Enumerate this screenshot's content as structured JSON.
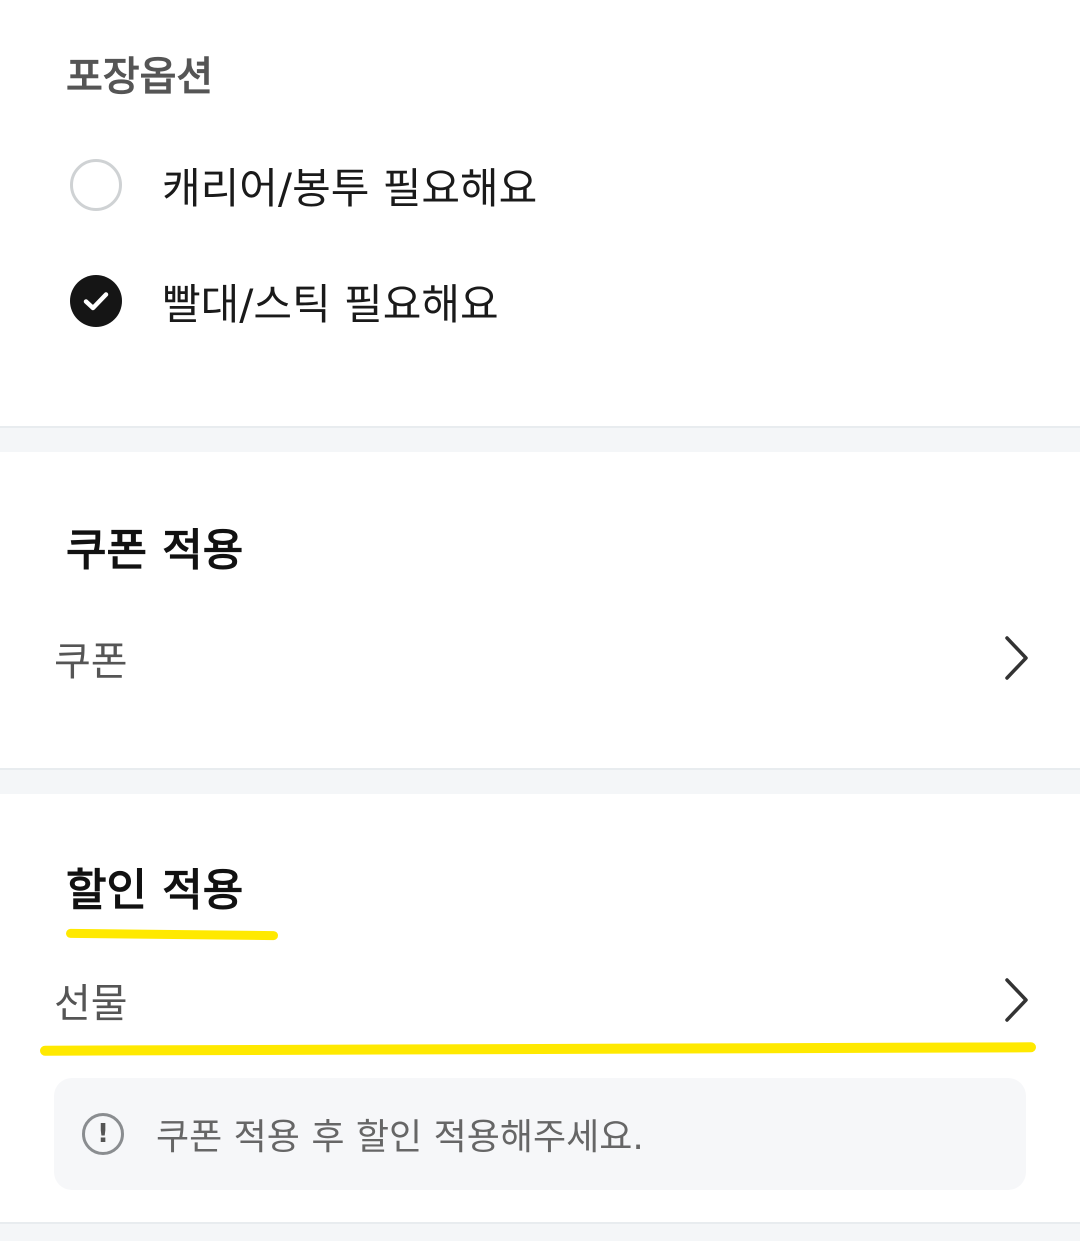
{
  "packaging": {
    "title": "포장옵션",
    "options": [
      {
        "label": "캐리어/봉투 필요해요",
        "checked": false
      },
      {
        "label": "빨대/스틱 필요해요",
        "checked": true
      }
    ]
  },
  "coupon": {
    "title": "쿠폰 적용",
    "row_label": "쿠폰"
  },
  "discount": {
    "title": "할인 적용",
    "row_label": "선물",
    "notice": "쿠폰 적용 후 할인 적용해주세요."
  },
  "icons": {
    "check": "check-icon",
    "chevron": "chevron-right-icon",
    "notice": "exclamation-circle-icon"
  },
  "colors": {
    "highlight": "#ffe900",
    "checked_radio": "#151515",
    "divider": "#f4f6f8"
  }
}
